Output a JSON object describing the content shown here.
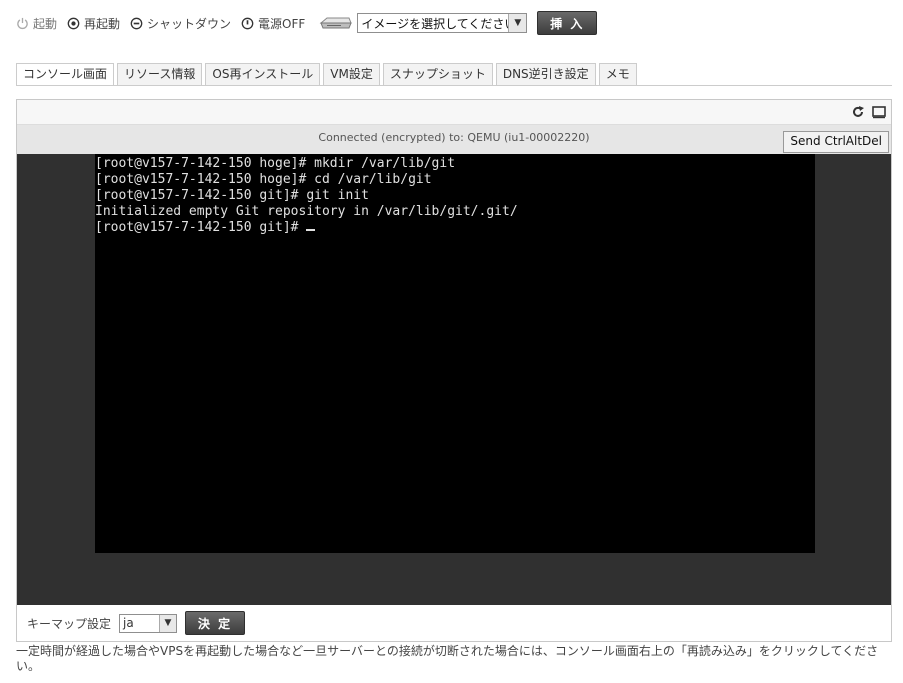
{
  "power": {
    "start_label": "起動",
    "restart_label": "再起動",
    "shutdown_label": "シャットダウン",
    "poweroff_label": "電源OFF"
  },
  "media": {
    "icon": "disk-drive-icon",
    "select_value": "イメージを選択してください",
    "insert_label": "挿 入"
  },
  "tabs": [
    {
      "label": "コンソール画面",
      "active": true
    },
    {
      "label": "リソース情報",
      "active": false
    },
    {
      "label": "OS再インストール",
      "active": false
    },
    {
      "label": "VM設定",
      "active": false
    },
    {
      "label": "スナップショット",
      "active": false
    },
    {
      "label": "DNS逆引き設定",
      "active": false
    },
    {
      "label": "メモ",
      "active": false
    }
  ],
  "console": {
    "status": "Connected (encrypted) to: QEMU (iu1-00002220)",
    "send_ctrl_alt_del": "Send CtrlAltDel",
    "reload_icon": "reload-icon",
    "fullscreen_icon": "fullscreen-icon",
    "lines": [
      "[root@v157-7-142-150 hoge]# mkdir /var/lib/git",
      "[root@v157-7-142-150 hoge]# cd /var/lib/git",
      "[root@v157-7-142-150 git]# git init",
      "Initialized empty Git repository in /var/lib/git/.git/",
      "[root@v157-7-142-150 git]# "
    ]
  },
  "keymap": {
    "label": "キーマップ設定",
    "value": "ja",
    "decide_label": "決 定"
  },
  "note": "一定時間が経過した場合やVPSを再起動した場合など一旦サーバーとの接続が切断された場合には、コンソール画面右上の「再読み込み」をクリックしてください。",
  "colors": {
    "console_bg": "#303030",
    "screen_bg": "#000000",
    "button_dark": "#4a4a4a"
  }
}
